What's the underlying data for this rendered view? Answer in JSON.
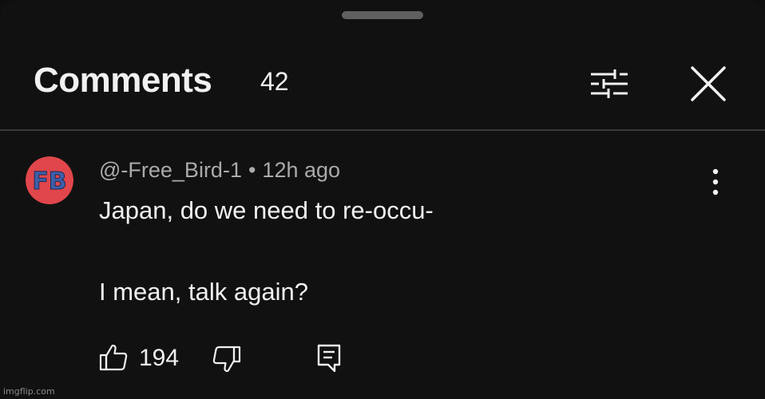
{
  "panel": {
    "title": "Comments",
    "comment_count": "42",
    "filter_icon": "sliders-icon",
    "close_icon": "close-icon"
  },
  "comment": {
    "author": "@-Free_Bird-1",
    "separator": "•",
    "time": "12h ago",
    "avatar_text": "FB",
    "avatar_colors": {
      "background": "#e0464b",
      "letters": "#3d5fa8"
    },
    "line1": "Japan, do we need to re-occu-",
    "line2": "I mean, talk again?",
    "like_count": "194",
    "icons": {
      "more": "more-vertical-icon",
      "like": "thumbs-up-icon",
      "dislike": "thumbs-down-icon",
      "reply": "reply-icon"
    }
  },
  "watermark": "imgflip.com",
  "colors": {
    "background": "#111111",
    "text_primary": "#f1f1f1",
    "text_secondary": "#aaaaaa",
    "divider": "#3a3a3a"
  }
}
